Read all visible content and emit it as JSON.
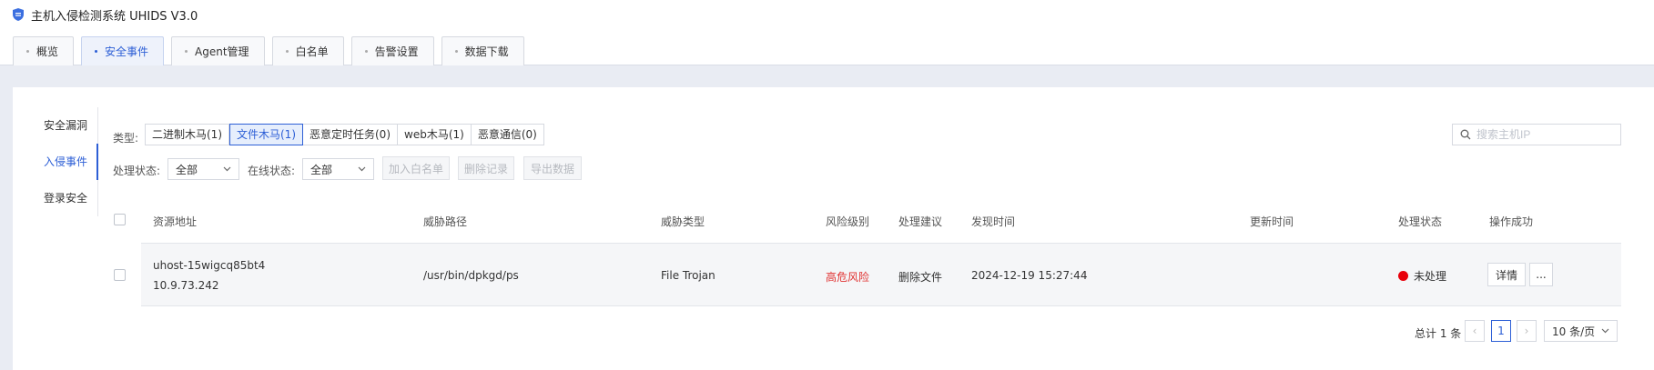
{
  "app": {
    "title": "主机入侵检测系统 UHIDS V3.0"
  },
  "tabs": [
    {
      "label": "概览",
      "active": false
    },
    {
      "label": "安全事件",
      "active": true
    },
    {
      "label": "Agent管理",
      "active": false
    },
    {
      "label": "白名单",
      "active": false
    },
    {
      "label": "告警设置",
      "active": false
    },
    {
      "label": "数据下载",
      "active": false
    }
  ],
  "sidebar": {
    "items": [
      {
        "label": "安全漏洞",
        "active": false
      },
      {
        "label": "入侵事件",
        "active": true
      },
      {
        "label": "登录安全",
        "active": false
      }
    ]
  },
  "filters": {
    "type_label": "类型:",
    "types": [
      {
        "label": "二进制木马(1)",
        "active": false
      },
      {
        "label": "文件木马(1)",
        "active": true
      },
      {
        "label": "恶意定时任务(0)",
        "active": false
      },
      {
        "label": "web木马(1)",
        "active": false
      },
      {
        "label": "恶意通信(0)",
        "active": false
      }
    ],
    "search_placeholder": "搜索主机IP",
    "process_status_label": "处理状态:",
    "process_status_value": "全部",
    "online_status_label": "在线状态:",
    "online_status_value": "全部",
    "actions": [
      "加入白名单",
      "删除记录",
      "导出数据"
    ]
  },
  "table": {
    "headers": {
      "resource": "资源地址",
      "path": "威胁路径",
      "type": "威胁类型",
      "risk": "风险级别",
      "advice": "处理建议",
      "found": "发现时间",
      "updated": "更新时间",
      "status": "处理状态",
      "ops": "操作成功"
    },
    "rows": [
      {
        "host": "uhost-15wigcq85bt4",
        "ip": "10.9.73.242",
        "path": "/usr/bin/dpkgd/ps",
        "type": "File Trojan",
        "risk": "高危风险",
        "advice": "删除文件",
        "found": "2024-12-19 15:27:44",
        "updated": "",
        "status": "未处理",
        "detail_label": "详情",
        "more_label": "..."
      }
    ]
  },
  "pagination": {
    "total": "总计 1 条",
    "prev": "‹",
    "page": "1",
    "next": "›",
    "page_size": "10 条/页"
  },
  "colors": {
    "accent": "#2d5fd6",
    "risk": "#e0302f",
    "status_dot": "#e8000b"
  },
  "icons": {
    "logo": "shield-icon",
    "search": "search-icon",
    "chevron": "chevron-down-icon"
  }
}
